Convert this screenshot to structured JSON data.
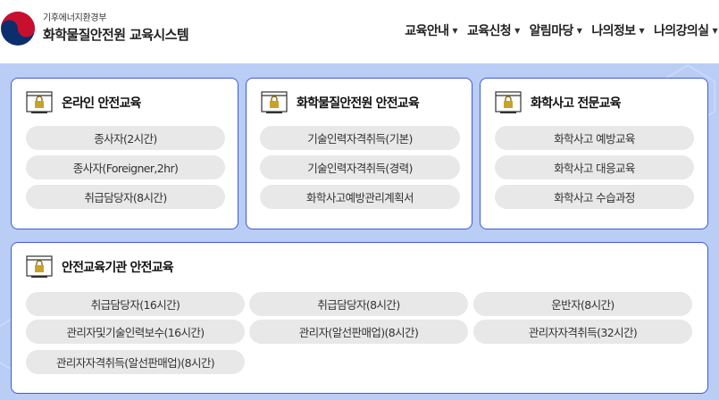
{
  "header": {
    "ministry": "기후에너지환경부",
    "title": "화학물질안전원 교육시스템",
    "nav": [
      {
        "label": "교육안내"
      },
      {
        "label": "교육신청"
      },
      {
        "label": "알림마당"
      },
      {
        "label": "나의정보"
      },
      {
        "label": "나의강의실"
      }
    ]
  },
  "cards": {
    "online": {
      "title": "온라인 안전교육",
      "items": [
        "종사자(2시간)",
        "종사자(Foreigner,2hr)",
        "취급담당자(8시간)"
      ]
    },
    "institute": {
      "title": "화학물질안전원 안전교육",
      "items": [
        "기술인력자격취득(기본)",
        "기술인력자격취득(경력)",
        "화학사고예방관리계획서"
      ]
    },
    "accident": {
      "title": "화학사고 전문교육",
      "items": [
        "화학사고 예방교육",
        "화학사고 대응교육",
        "화학사고 수습과정"
      ]
    },
    "agency": {
      "title": "안전교육기관 안전교육",
      "items": [
        "취급담당자(16시간)",
        "취급담당자(8시간)",
        "운반자(8시간)",
        "관리자및기술인력보수(16시간)",
        "관리자(알선판매업)(8시간)",
        "관리자자격취득(32시간)",
        "관리자자격취득(알선판매업)(8시간)"
      ]
    }
  },
  "colors": {
    "background": "#b9cdf5",
    "card_border": "#3f5bd8",
    "pill": "#e8e8e8",
    "logo_red": "#c8102e",
    "logo_blue": "#0b2e6f"
  },
  "icons": {
    "logo": "government-emblem-icon",
    "card": "monitor-lock-icon",
    "dropdown": "caret-down-icon"
  }
}
